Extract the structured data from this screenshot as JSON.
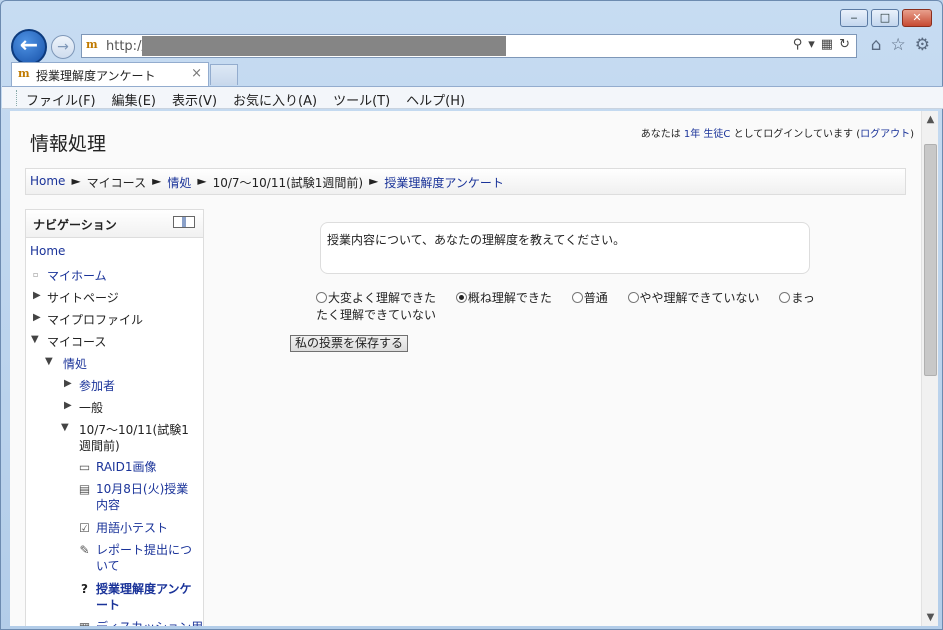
{
  "browser": {
    "address_prefix": "http://",
    "tab_title": "授業理解度アンケート",
    "tab_close": "×",
    "menu": [
      "ファイル(F)",
      "編集(E)",
      "表示(V)",
      "お気に入り(A)",
      "ツール(T)",
      "ヘルプ(H)"
    ],
    "favicon_glyph": "m",
    "window_controls": {
      "minimize": "‒",
      "maximize": "□",
      "close": "✕"
    }
  },
  "site": {
    "title": "情報処理",
    "login_prefix": "あなたは",
    "login_user": "1年 生徒C",
    "login_middle": "としてログインしています (",
    "logout": "ログアウト",
    "login_suffix": ")"
  },
  "breadcrumb": [
    {
      "label": "Home",
      "link": true
    },
    {
      "label": "►",
      "link": false
    },
    {
      "label": "マイコース",
      "link": false
    },
    {
      "label": "►",
      "link": false
    },
    {
      "label": "情処",
      "link": true
    },
    {
      "label": "►",
      "link": false
    },
    {
      "label": "10/7～10/11(試験1週間前)",
      "link": false
    },
    {
      "label": "►",
      "link": false
    },
    {
      "label": "授業理解度アンケート",
      "link": true
    }
  ],
  "navigation": {
    "title": "ナビゲーション",
    "home": "Home",
    "items": {
      "my_home": "マイホーム",
      "site_pages": "サイトページ",
      "my_profile": "マイプロファイル",
      "my_courses": "マイコース",
      "course": "情処",
      "participants": "参加者",
      "general": "一般",
      "week_line1": "10/7～10/11(試験1",
      "week_line2": "週間前)",
      "raid_image": "RAID1画像",
      "oct8_line1": "10月8日(火)授業",
      "oct8_line2": "内容",
      "quiz": "用語小テスト",
      "report_line1": "レポート提出につ",
      "report_line2": "いて",
      "survey_line1": "授業理解度アンケ",
      "survey_line2": "ート",
      "discussion": "ディスカッション用"
    }
  },
  "poll": {
    "question": "授業内容について、あなたの理解度を教えてください。",
    "options": [
      "大変よく理解できた",
      "概ね理解できた",
      "普通",
      "やや理解できていない",
      "まったく理解できていない"
    ],
    "selected_index": 1,
    "save_label": "私の投票を保存する"
  }
}
